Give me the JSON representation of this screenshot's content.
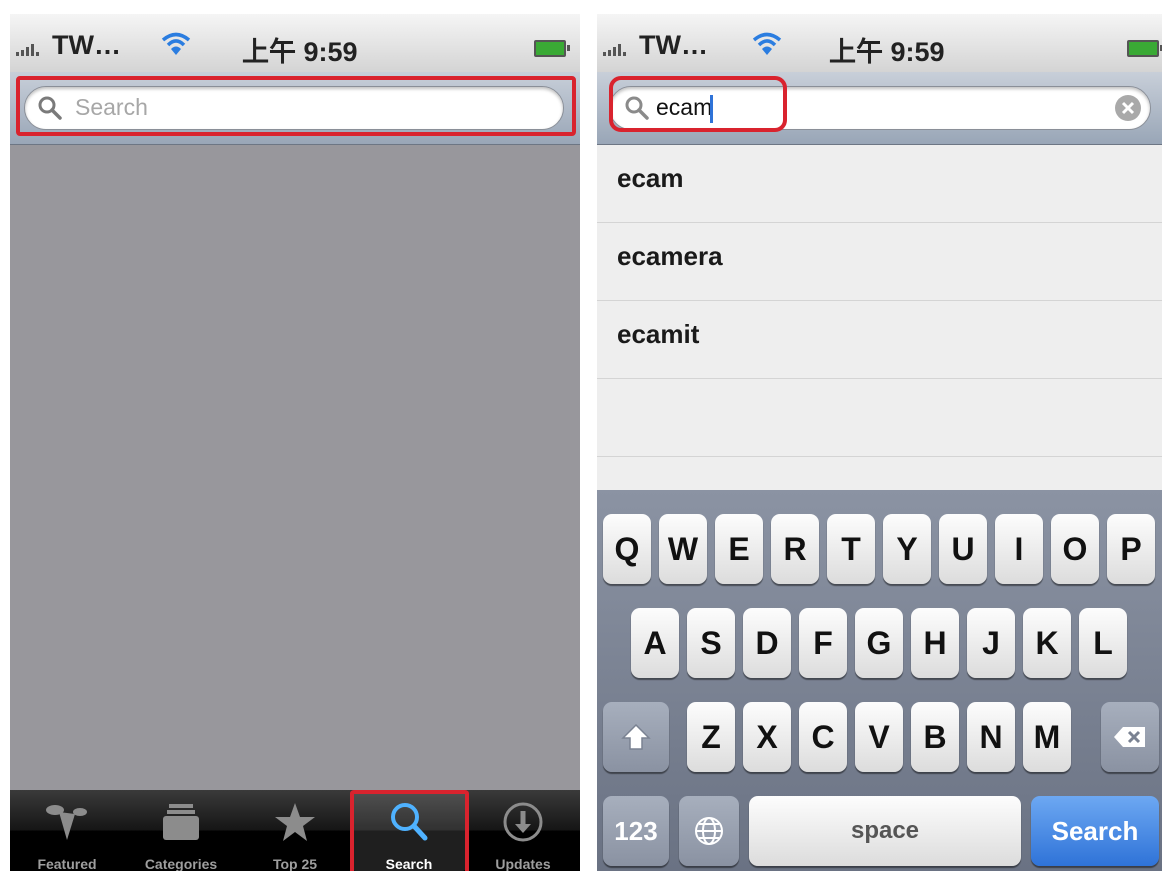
{
  "status_bar": {
    "carrier": "TW…",
    "time": "上午 9:59"
  },
  "left": {
    "search_placeholder": "Search",
    "tabs": [
      {
        "label": "Featured",
        "icon": "featured-icon"
      },
      {
        "label": "Categories",
        "icon": "categories-icon"
      },
      {
        "label": "Top 25",
        "icon": "star-icon"
      },
      {
        "label": "Search",
        "icon": "search-icon"
      },
      {
        "label": "Updates",
        "icon": "download-icon"
      }
    ],
    "active_tab": "Search"
  },
  "right": {
    "search_value": "ecam",
    "suggestions": [
      "ecam",
      "ecamera",
      "ecamit"
    ],
    "keyboard": {
      "row1": [
        "Q",
        "W",
        "E",
        "R",
        "T",
        "Y",
        "U",
        "I",
        "O",
        "P"
      ],
      "row2": [
        "A",
        "S",
        "D",
        "F",
        "G",
        "H",
        "J",
        "K",
        "L"
      ],
      "row3": [
        "Z",
        "X",
        "C",
        "V",
        "B",
        "N",
        "M"
      ],
      "numbers_key": "123",
      "space_key": "space",
      "search_key": "Search"
    }
  },
  "colors": {
    "highlight": "#d9232e",
    "search_key": "#2f73d8",
    "tab_bar": "#151515"
  }
}
